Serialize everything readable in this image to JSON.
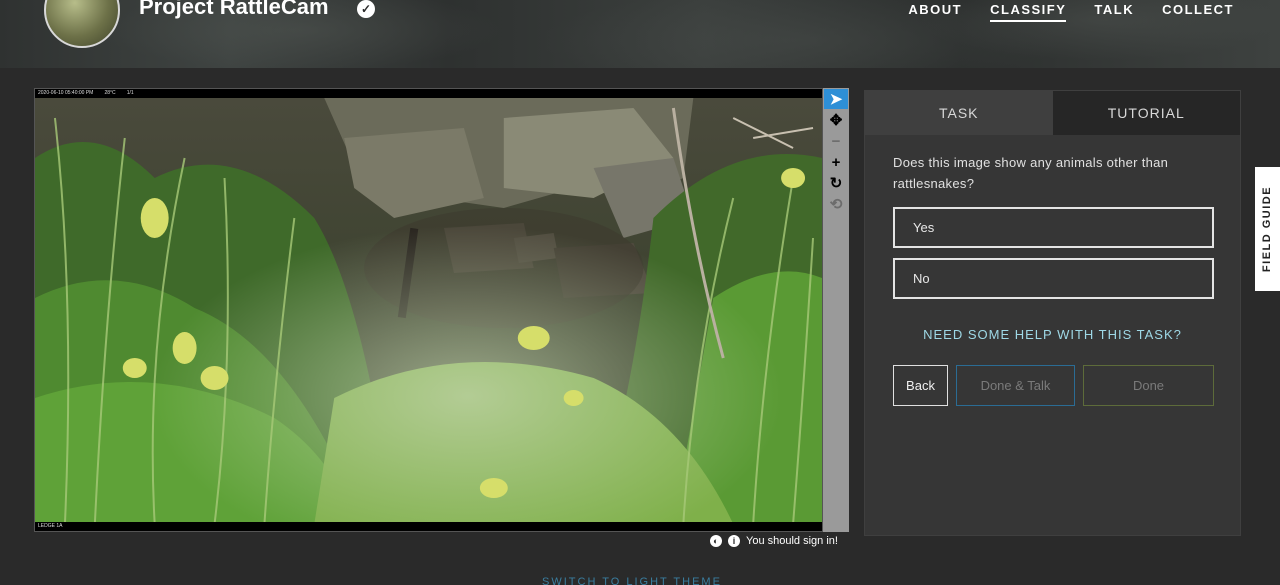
{
  "header": {
    "project_title": "Project RattleCam",
    "nav": [
      {
        "label": "ABOUT",
        "active": false
      },
      {
        "label": "CLASSIFY",
        "active": true
      },
      {
        "label": "TALK",
        "active": false
      },
      {
        "label": "COLLECT",
        "active": false
      }
    ]
  },
  "viewer": {
    "camera_timestamp": "2020-06-10 05:40:00 PM",
    "camera_temperature": "28°C",
    "camera_counter": "1/1",
    "camera_location": "LEDGE 1A",
    "toolbar": [
      {
        "name": "pointer-tool-icon",
        "glyph": "➤",
        "active": true
      },
      {
        "name": "move-tool-icon",
        "glyph": "✥",
        "active": false
      },
      {
        "name": "zoom-out-icon",
        "glyph": "−",
        "active": false
      },
      {
        "name": "zoom-in-icon",
        "glyph": "+",
        "active": false
      },
      {
        "name": "rotate-icon",
        "glyph": "↻",
        "active": false
      },
      {
        "name": "reset-icon",
        "glyph": "⟲",
        "active": false
      }
    ],
    "sign_in_notice": "You should sign in!"
  },
  "task_panel": {
    "tabs": [
      {
        "label": "TASK",
        "active": true
      },
      {
        "label": "TUTORIAL",
        "active": false
      }
    ],
    "question": "Does this image show any animals other than rattlesnakes?",
    "answers": [
      "Yes",
      "No"
    ],
    "help_link": "NEED SOME HELP WITH THIS TASK?",
    "buttons": {
      "back": "Back",
      "done_talk": "Done & Talk",
      "done": "Done"
    }
  },
  "field_guide_label": "FIELD GUIDE",
  "theme_switch_label": "SWITCH TO LIGHT THEME"
}
